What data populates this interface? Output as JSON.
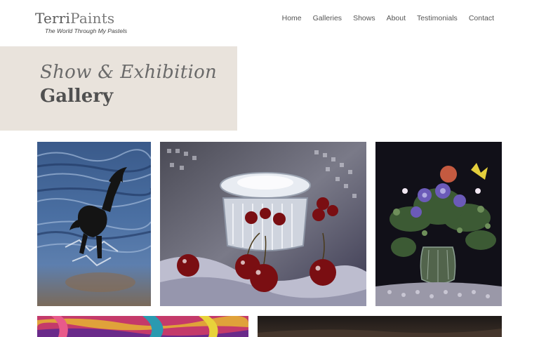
{
  "brand": {
    "name_part1": "Terri",
    "name_part2": "Paints",
    "tagline": "The World Through My Pastels"
  },
  "nav": {
    "items": [
      "Home",
      "Galleries",
      "Shows",
      "About",
      "Testimonials",
      "Contact"
    ]
  },
  "hero": {
    "line1": "Show & Exhibition",
    "line2": "Gallery"
  },
  "gallery": {
    "images": [
      {
        "subject": "horse-in-water-painting"
      },
      {
        "subject": "crystal-bowl-and-cherries-painting"
      },
      {
        "subject": "flowers-in-vase-painting"
      },
      {
        "subject": "colorful-fabric-painting"
      },
      {
        "subject": "dark-landscape-painting"
      }
    ]
  },
  "colors": {
    "hero_background": "#e9e3dc",
    "text": "#555555"
  }
}
